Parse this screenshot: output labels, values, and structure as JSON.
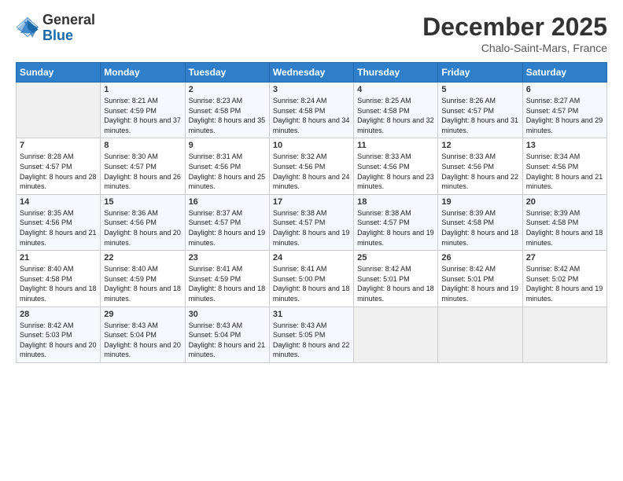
{
  "header": {
    "logo_general": "General",
    "logo_blue": "Blue",
    "title": "December 2025",
    "location": "Chalo-Saint-Mars, France"
  },
  "weekdays": [
    "Sunday",
    "Monday",
    "Tuesday",
    "Wednesday",
    "Thursday",
    "Friday",
    "Saturday"
  ],
  "weeks": [
    [
      {
        "day": "",
        "sunrise": "",
        "sunset": "",
        "daylight": ""
      },
      {
        "day": "1",
        "sunrise": "Sunrise: 8:21 AM",
        "sunset": "Sunset: 4:59 PM",
        "daylight": "Daylight: 8 hours and 37 minutes."
      },
      {
        "day": "2",
        "sunrise": "Sunrise: 8:23 AM",
        "sunset": "Sunset: 4:58 PM",
        "daylight": "Daylight: 8 hours and 35 minutes."
      },
      {
        "day": "3",
        "sunrise": "Sunrise: 8:24 AM",
        "sunset": "Sunset: 4:58 PM",
        "daylight": "Daylight: 8 hours and 34 minutes."
      },
      {
        "day": "4",
        "sunrise": "Sunrise: 8:25 AM",
        "sunset": "Sunset: 4:58 PM",
        "daylight": "Daylight: 8 hours and 32 minutes."
      },
      {
        "day": "5",
        "sunrise": "Sunrise: 8:26 AM",
        "sunset": "Sunset: 4:57 PM",
        "daylight": "Daylight: 8 hours and 31 minutes."
      },
      {
        "day": "6",
        "sunrise": "Sunrise: 8:27 AM",
        "sunset": "Sunset: 4:57 PM",
        "daylight": "Daylight: 8 hours and 29 minutes."
      }
    ],
    [
      {
        "day": "7",
        "sunrise": "Sunrise: 8:28 AM",
        "sunset": "Sunset: 4:57 PM",
        "daylight": "Daylight: 8 hours and 28 minutes."
      },
      {
        "day": "8",
        "sunrise": "Sunrise: 8:30 AM",
        "sunset": "Sunset: 4:57 PM",
        "daylight": "Daylight: 8 hours and 26 minutes."
      },
      {
        "day": "9",
        "sunrise": "Sunrise: 8:31 AM",
        "sunset": "Sunset: 4:56 PM",
        "daylight": "Daylight: 8 hours and 25 minutes."
      },
      {
        "day": "10",
        "sunrise": "Sunrise: 8:32 AM",
        "sunset": "Sunset: 4:56 PM",
        "daylight": "Daylight: 8 hours and 24 minutes."
      },
      {
        "day": "11",
        "sunrise": "Sunrise: 8:33 AM",
        "sunset": "Sunset: 4:56 PM",
        "daylight": "Daylight: 8 hours and 23 minutes."
      },
      {
        "day": "12",
        "sunrise": "Sunrise: 8:33 AM",
        "sunset": "Sunset: 4:56 PM",
        "daylight": "Daylight: 8 hours and 22 minutes."
      },
      {
        "day": "13",
        "sunrise": "Sunrise: 8:34 AM",
        "sunset": "Sunset: 4:56 PM",
        "daylight": "Daylight: 8 hours and 21 minutes."
      }
    ],
    [
      {
        "day": "14",
        "sunrise": "Sunrise: 8:35 AM",
        "sunset": "Sunset: 4:56 PM",
        "daylight": "Daylight: 8 hours and 21 minutes."
      },
      {
        "day": "15",
        "sunrise": "Sunrise: 8:36 AM",
        "sunset": "Sunset: 4:56 PM",
        "daylight": "Daylight: 8 hours and 20 minutes."
      },
      {
        "day": "16",
        "sunrise": "Sunrise: 8:37 AM",
        "sunset": "Sunset: 4:57 PM",
        "daylight": "Daylight: 8 hours and 19 minutes."
      },
      {
        "day": "17",
        "sunrise": "Sunrise: 8:38 AM",
        "sunset": "Sunset: 4:57 PM",
        "daylight": "Daylight: 8 hours and 19 minutes."
      },
      {
        "day": "18",
        "sunrise": "Sunrise: 8:38 AM",
        "sunset": "Sunset: 4:57 PM",
        "daylight": "Daylight: 8 hours and 19 minutes."
      },
      {
        "day": "19",
        "sunrise": "Sunrise: 8:39 AM",
        "sunset": "Sunset: 4:58 PM",
        "daylight": "Daylight: 8 hours and 18 minutes."
      },
      {
        "day": "20",
        "sunrise": "Sunrise: 8:39 AM",
        "sunset": "Sunset: 4:58 PM",
        "daylight": "Daylight: 8 hours and 18 minutes."
      }
    ],
    [
      {
        "day": "21",
        "sunrise": "Sunrise: 8:40 AM",
        "sunset": "Sunset: 4:58 PM",
        "daylight": "Daylight: 8 hours and 18 minutes."
      },
      {
        "day": "22",
        "sunrise": "Sunrise: 8:40 AM",
        "sunset": "Sunset: 4:59 PM",
        "daylight": "Daylight: 8 hours and 18 minutes."
      },
      {
        "day": "23",
        "sunrise": "Sunrise: 8:41 AM",
        "sunset": "Sunset: 4:59 PM",
        "daylight": "Daylight: 8 hours and 18 minutes."
      },
      {
        "day": "24",
        "sunrise": "Sunrise: 8:41 AM",
        "sunset": "Sunset: 5:00 PM",
        "daylight": "Daylight: 8 hours and 18 minutes."
      },
      {
        "day": "25",
        "sunrise": "Sunrise: 8:42 AM",
        "sunset": "Sunset: 5:01 PM",
        "daylight": "Daylight: 8 hours and 18 minutes."
      },
      {
        "day": "26",
        "sunrise": "Sunrise: 8:42 AM",
        "sunset": "Sunset: 5:01 PM",
        "daylight": "Daylight: 8 hours and 19 minutes."
      },
      {
        "day": "27",
        "sunrise": "Sunrise: 8:42 AM",
        "sunset": "Sunset: 5:02 PM",
        "daylight": "Daylight: 8 hours and 19 minutes."
      }
    ],
    [
      {
        "day": "28",
        "sunrise": "Sunrise: 8:42 AM",
        "sunset": "Sunset: 5:03 PM",
        "daylight": "Daylight: 8 hours and 20 minutes."
      },
      {
        "day": "29",
        "sunrise": "Sunrise: 8:43 AM",
        "sunset": "Sunset: 5:04 PM",
        "daylight": "Daylight: 8 hours and 20 minutes."
      },
      {
        "day": "30",
        "sunrise": "Sunrise: 8:43 AM",
        "sunset": "Sunset: 5:04 PM",
        "daylight": "Daylight: 8 hours and 21 minutes."
      },
      {
        "day": "31",
        "sunrise": "Sunrise: 8:43 AM",
        "sunset": "Sunset: 5:05 PM",
        "daylight": "Daylight: 8 hours and 22 minutes."
      },
      {
        "day": "",
        "sunrise": "",
        "sunset": "",
        "daylight": ""
      },
      {
        "day": "",
        "sunrise": "",
        "sunset": "",
        "daylight": ""
      },
      {
        "day": "",
        "sunrise": "",
        "sunset": "",
        "daylight": ""
      }
    ]
  ]
}
